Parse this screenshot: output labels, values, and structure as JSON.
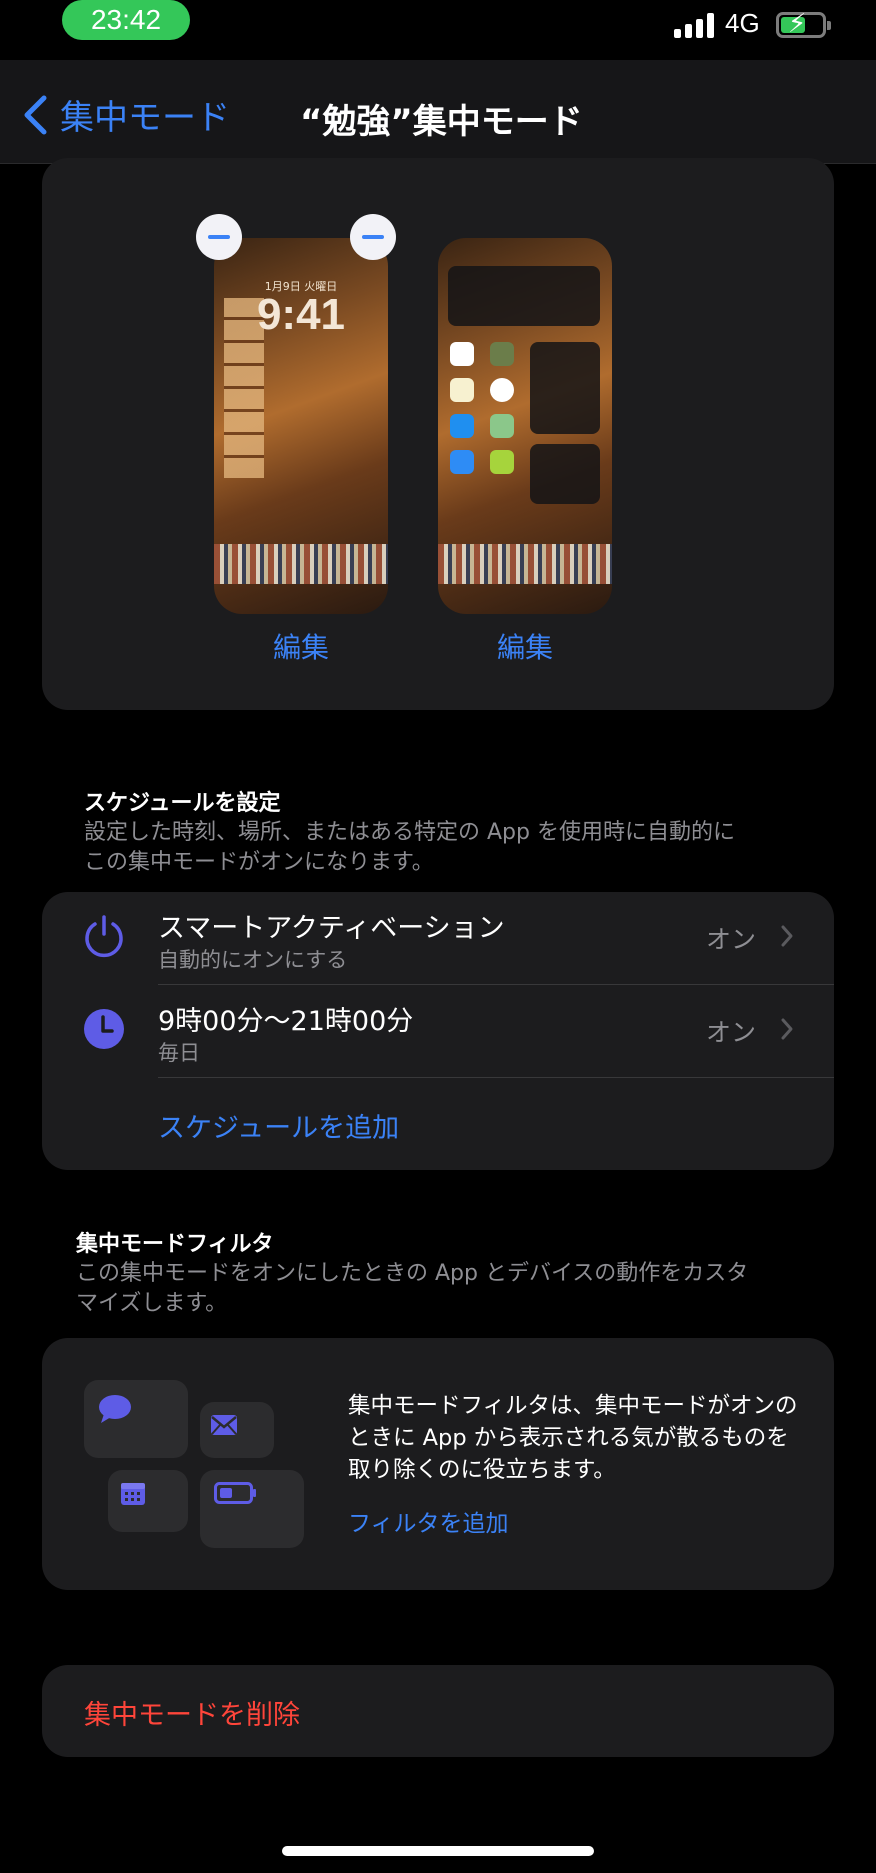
{
  "status": {
    "time": "23:42",
    "network": "4G",
    "battery_charging": true
  },
  "nav": {
    "back_label": "集中モード",
    "title": "“勉強”集中モード"
  },
  "wallpapers": {
    "lock": {
      "date": "1月9日 火曜日",
      "time": "9:41",
      "edit_label": "編集"
    },
    "home": {
      "edit_label": "編集"
    }
  },
  "schedule": {
    "header": "スケジュールを設定",
    "description_line1": "設定した時刻、場所、またはある特定の App を使用時に自動的に",
    "description_line2": "この集中モードがオンになります。",
    "rows": [
      {
        "title": "スマートアクティベーション",
        "subtitle": "自動的にオンにする",
        "value": "オン",
        "icon": "power-icon"
      },
      {
        "title": "9時00分〜21時00分",
        "subtitle": "毎日",
        "value": "オン",
        "icon": "clock-icon"
      }
    ],
    "add_label": "スケジュールを追加"
  },
  "filter": {
    "header": "集中モードフィルタ",
    "description_line1": "この集中モードをオンにしたときの App とデバイスの動作をカスタ",
    "description_line2": "マイズします。",
    "info_text": "集中モードフィルタは、集中モードがオンのときに App から表示される気が散るものを取り除くのに役立ちます。",
    "add_label": "フィルタを追加",
    "icons": [
      "message-icon",
      "mail-icon",
      "calendar-icon",
      "battery-icon"
    ]
  },
  "delete": {
    "label": "集中モードを削除"
  },
  "colors": {
    "accent": "#3b82f6",
    "destructive": "#ff453a",
    "card": "#1c1c1e",
    "secondary_text": "#8e8e93",
    "filter_icon": "#5e5ce6"
  }
}
